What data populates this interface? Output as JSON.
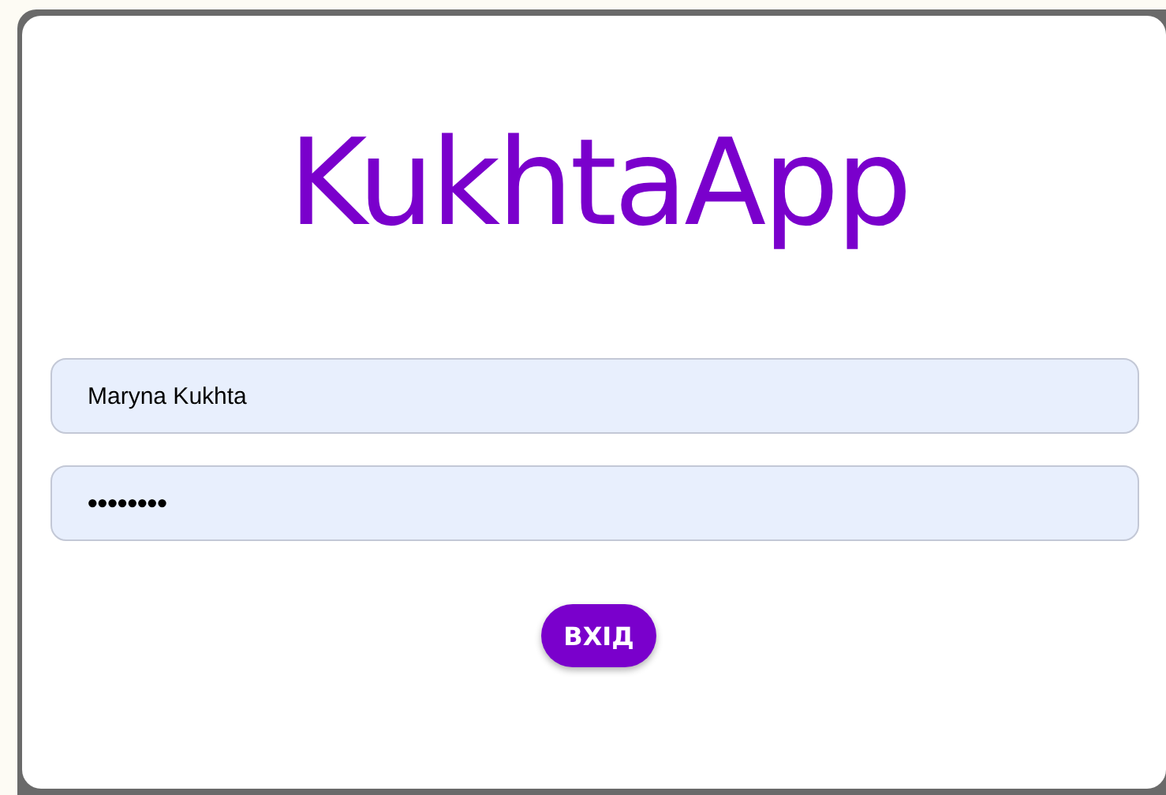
{
  "logo": "KukhtaApp",
  "fields": [
    {
      "kind": "text",
      "value": "Maryna Kukhta"
    },
    {
      "kind": "password",
      "value": "••••••••"
    }
  ],
  "button": "ВХІД"
}
